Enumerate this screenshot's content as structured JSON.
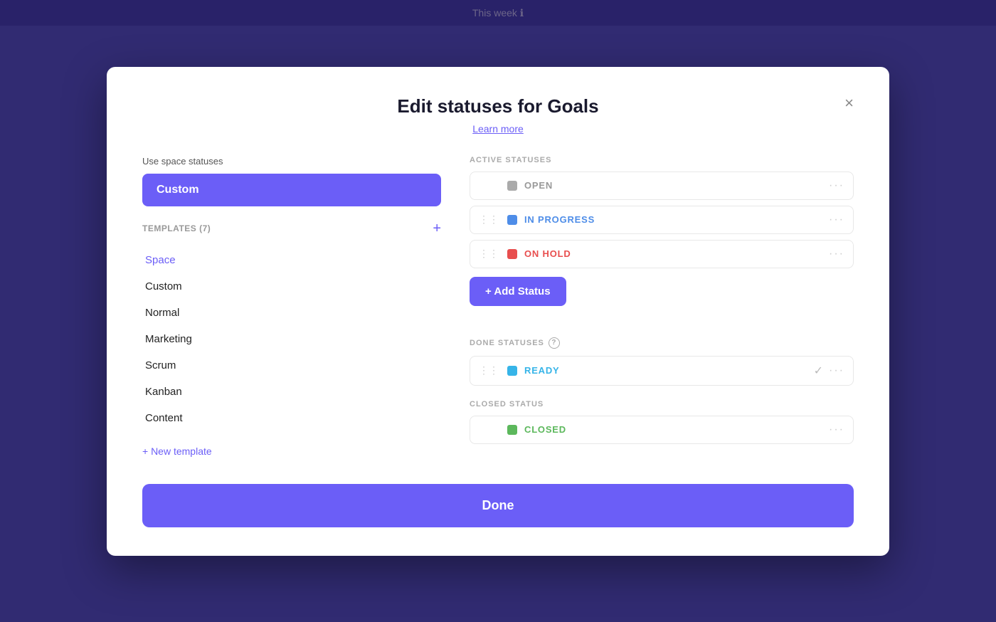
{
  "topbar": {
    "title": "This week",
    "info_icon": "ℹ"
  },
  "modal": {
    "title": "Edit statuses for Goals",
    "learn_more": "Learn more",
    "close_label": "×",
    "left": {
      "use_space_label": "Use space statuses",
      "custom_active": "Custom",
      "templates_label": "TEMPLATES (7)",
      "templates_plus": "+",
      "template_items": [
        {
          "label": "Space",
          "active": true
        },
        {
          "label": "Custom",
          "active": false
        },
        {
          "label": "Normal",
          "active": false
        },
        {
          "label": "Marketing",
          "active": false
        },
        {
          "label": "Scrum",
          "active": false
        },
        {
          "label": "Kanban",
          "active": false
        },
        {
          "label": "Content",
          "active": false
        }
      ],
      "new_template_link": "+ New template"
    },
    "right": {
      "active_statuses_label": "ACTIVE STATUSES",
      "active_statuses": [
        {
          "name": "OPEN",
          "color_class": "gray",
          "text_class": "gray-text",
          "has_drag": false
        },
        {
          "name": "IN PROGRESS",
          "color_class": "blue",
          "text_class": "blue-text",
          "has_drag": true
        },
        {
          "name": "ON HOLD",
          "color_class": "red",
          "text_class": "red-text",
          "has_drag": true
        }
      ],
      "add_status_label": "+ Add Status",
      "done_statuses_label": "DONE STATUSES",
      "done_statuses": [
        {
          "name": "READY",
          "color_class": "cyan",
          "text_class": "cyan-text",
          "has_check": true
        }
      ],
      "closed_status_label": "CLOSED STATUS",
      "closed_statuses": [
        {
          "name": "CLOSED",
          "color_class": "green",
          "text_class": "green-text"
        }
      ]
    },
    "done_button": "Done"
  }
}
